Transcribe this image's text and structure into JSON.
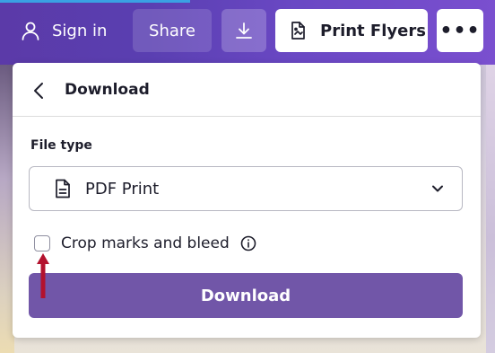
{
  "topbar": {
    "sign_in_label": "Sign in",
    "share_label": "Share",
    "download_icon": "download-icon",
    "print_flyers_label": "Print Flyers",
    "more_label": "•••",
    "accent_color": "#5b3aa8"
  },
  "panel": {
    "title": "Download",
    "file_type_label": "File type",
    "file_type_value": "PDF Print",
    "crop_marks_label": "Crop marks and bleed",
    "crop_marks_checked": false,
    "download_button_label": "Download",
    "download_button_color": "#7156a8",
    "annotation_arrow_color": "#b3122e"
  }
}
